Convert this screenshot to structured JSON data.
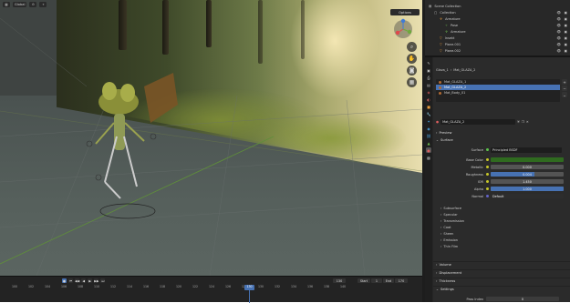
{
  "header": {
    "mode": "Object Mode",
    "orientation": "Global",
    "options_label": "Options"
  },
  "viewport": {
    "background": "forest backdrop",
    "gizmo_axes": [
      "X",
      "Y",
      "Z"
    ]
  },
  "timeline": {
    "frame_ticks": [
      "100",
      "102",
      "104",
      "106",
      "108",
      "110",
      "112",
      "114",
      "116",
      "118",
      "120",
      "122",
      "124",
      "126",
      "128",
      "130",
      "132",
      "134",
      "136",
      "138",
      "140"
    ],
    "current_frame": "130",
    "frame_field": "130",
    "start_label": "Start",
    "start_value": "1",
    "end_label": "End",
    "end_value": "170"
  },
  "outliner": {
    "items": [
      {
        "label": "Scene Collection",
        "indent": 0,
        "icon": "scene-collection-icon"
      },
      {
        "label": "Collection",
        "indent": 1,
        "icon": "collection-icon"
      },
      {
        "label": "Armature",
        "indent": 2,
        "icon": "armature-icon"
      },
      {
        "label": "Pose",
        "indent": 3,
        "icon": "pose-icon"
      },
      {
        "label": "Armature",
        "indent": 3,
        "icon": "armature-data-icon"
      },
      {
        "label": "Insekt",
        "indent": 2,
        "icon": "mesh-icon"
      },
      {
        "label": "Plane.001",
        "indent": 2,
        "icon": "mesh-icon"
      },
      {
        "label": "Plane.002",
        "indent": 2,
        "icon": "mesh-icon"
      }
    ]
  },
  "properties": {
    "object_crumb": "Glaza_1",
    "material_crumb": "Mat_GLAZA_2",
    "material_slots": [
      {
        "label": "Mat_GLAZA_1",
        "selected": false
      },
      {
        "label": "Mat_GLAZA_2",
        "selected": true
      },
      {
        "label": "Mat_Body_01",
        "selected": false
      }
    ],
    "material_name": "Mat_GLAZA_2",
    "preview_label": "Preview",
    "surface_label": "Surface",
    "surface_row": {
      "label": "Surface",
      "value": "Principled BSDF"
    },
    "params": [
      {
        "label": "Base Color",
        "value": "",
        "kind": "color",
        "color": "#2f6a1f"
      },
      {
        "label": "Metallic",
        "value": "0.000",
        "kind": "num",
        "fill": 0
      },
      {
        "label": "Roughness",
        "value": "0.004",
        "kind": "num",
        "fill": 0.6
      },
      {
        "label": "IOR",
        "value": "1.450",
        "kind": "num",
        "fill": 0
      },
      {
        "label": "Alpha",
        "value": "1.000",
        "kind": "num",
        "fill": 1
      },
      {
        "label": "Normal",
        "value": "Default",
        "kind": "text",
        "fill": 0
      }
    ],
    "subsections": [
      "Subsurface",
      "Specular",
      "Transmission",
      "Coat",
      "Sheen",
      "Emission",
      "Thin Film"
    ],
    "sections": [
      "Volume",
      "Displacement",
      "Thickness",
      "Settings"
    ],
    "pass_index_label": "Pass Index",
    "pass_index_value": "0"
  }
}
